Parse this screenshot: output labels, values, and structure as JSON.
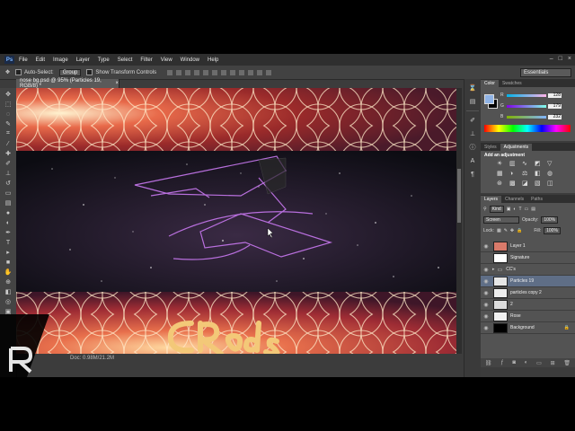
{
  "menubar": {
    "logo": "Ps",
    "items": [
      "File",
      "Edit",
      "Image",
      "Layer",
      "Type",
      "Select",
      "Filter",
      "View",
      "Window",
      "Help"
    ],
    "window_controls": [
      "–",
      "□",
      "×"
    ]
  },
  "options_bar": {
    "tool_icon": "move-tool-icon",
    "auto_select_label": "Auto-Select:",
    "auto_select_value": "Group",
    "show_transform_label": "Show Transform Controls",
    "workspace": "Essentials"
  },
  "document": {
    "tab_title": "nose bg.psd @ 95% (Particles 19, RGB/8) *",
    "status_text": "Doc: 0.98M/21.2M"
  },
  "color_panel": {
    "tabs": [
      "Color",
      "Swatches"
    ],
    "channels": [
      {
        "label": "R",
        "value": "128",
        "level": 0.5
      },
      {
        "label": "G",
        "value": "179",
        "level": 0.7
      },
      {
        "label": "B",
        "value": "232",
        "level": 0.91
      }
    ],
    "foreground_color": "#8fb3e6",
    "background_color": "#000000"
  },
  "adjustments_panel": {
    "tabs": [
      "Styles",
      "Adjustments"
    ],
    "title": "Add an adjustment",
    "icons": [
      "brightness-icon",
      "levels-icon",
      "curves-icon",
      "exposure-icon",
      "gradient-icon",
      "vibrance-icon",
      "hue-icon",
      "balance-icon",
      "bw-icon",
      "photo-filter-icon",
      "channel-mixer-icon",
      "lookup-icon",
      "invert-icon",
      "posterize-icon",
      "threshold-icon"
    ]
  },
  "layers_panel": {
    "tabs": [
      "Layers",
      "Channels",
      "Paths"
    ],
    "filter_kind": "Kind",
    "blend_mode": "Screen",
    "opacity_label": "Opacity:",
    "opacity_value": "100%",
    "lock_label": "Lock:",
    "fill_label": "Fill:",
    "fill_value": "100%",
    "layers": [
      {
        "name": "Layer 1",
        "visible": true,
        "thumb": "#d97a6a",
        "selected": false
      },
      {
        "name": "Signature",
        "visible": false,
        "thumb": "#ffffff",
        "selected": false
      },
      {
        "name": "CC's",
        "visible": true,
        "thumb": "#3a3a3a",
        "selected": false,
        "folder": true
      },
      {
        "name": "Particles 19",
        "visible": true,
        "thumb": "#e6e6e6",
        "selected": true
      },
      {
        "name": "particles copy 2",
        "visible": true,
        "thumb": "#eeeeee",
        "selected": false
      },
      {
        "name": "2",
        "visible": true,
        "thumb": "#dcdcdc",
        "selected": false
      },
      {
        "name": "Rose",
        "visible": true,
        "thumb": "#f0f0f0",
        "selected": false
      },
      {
        "name": "Background",
        "visible": true,
        "thumb": "#000000",
        "selected": false,
        "locked": true
      }
    ]
  },
  "colors": {
    "banner_red": "#b32a2a",
    "banner_gold": "#f3c878",
    "neon_purple": "#c060e0"
  }
}
